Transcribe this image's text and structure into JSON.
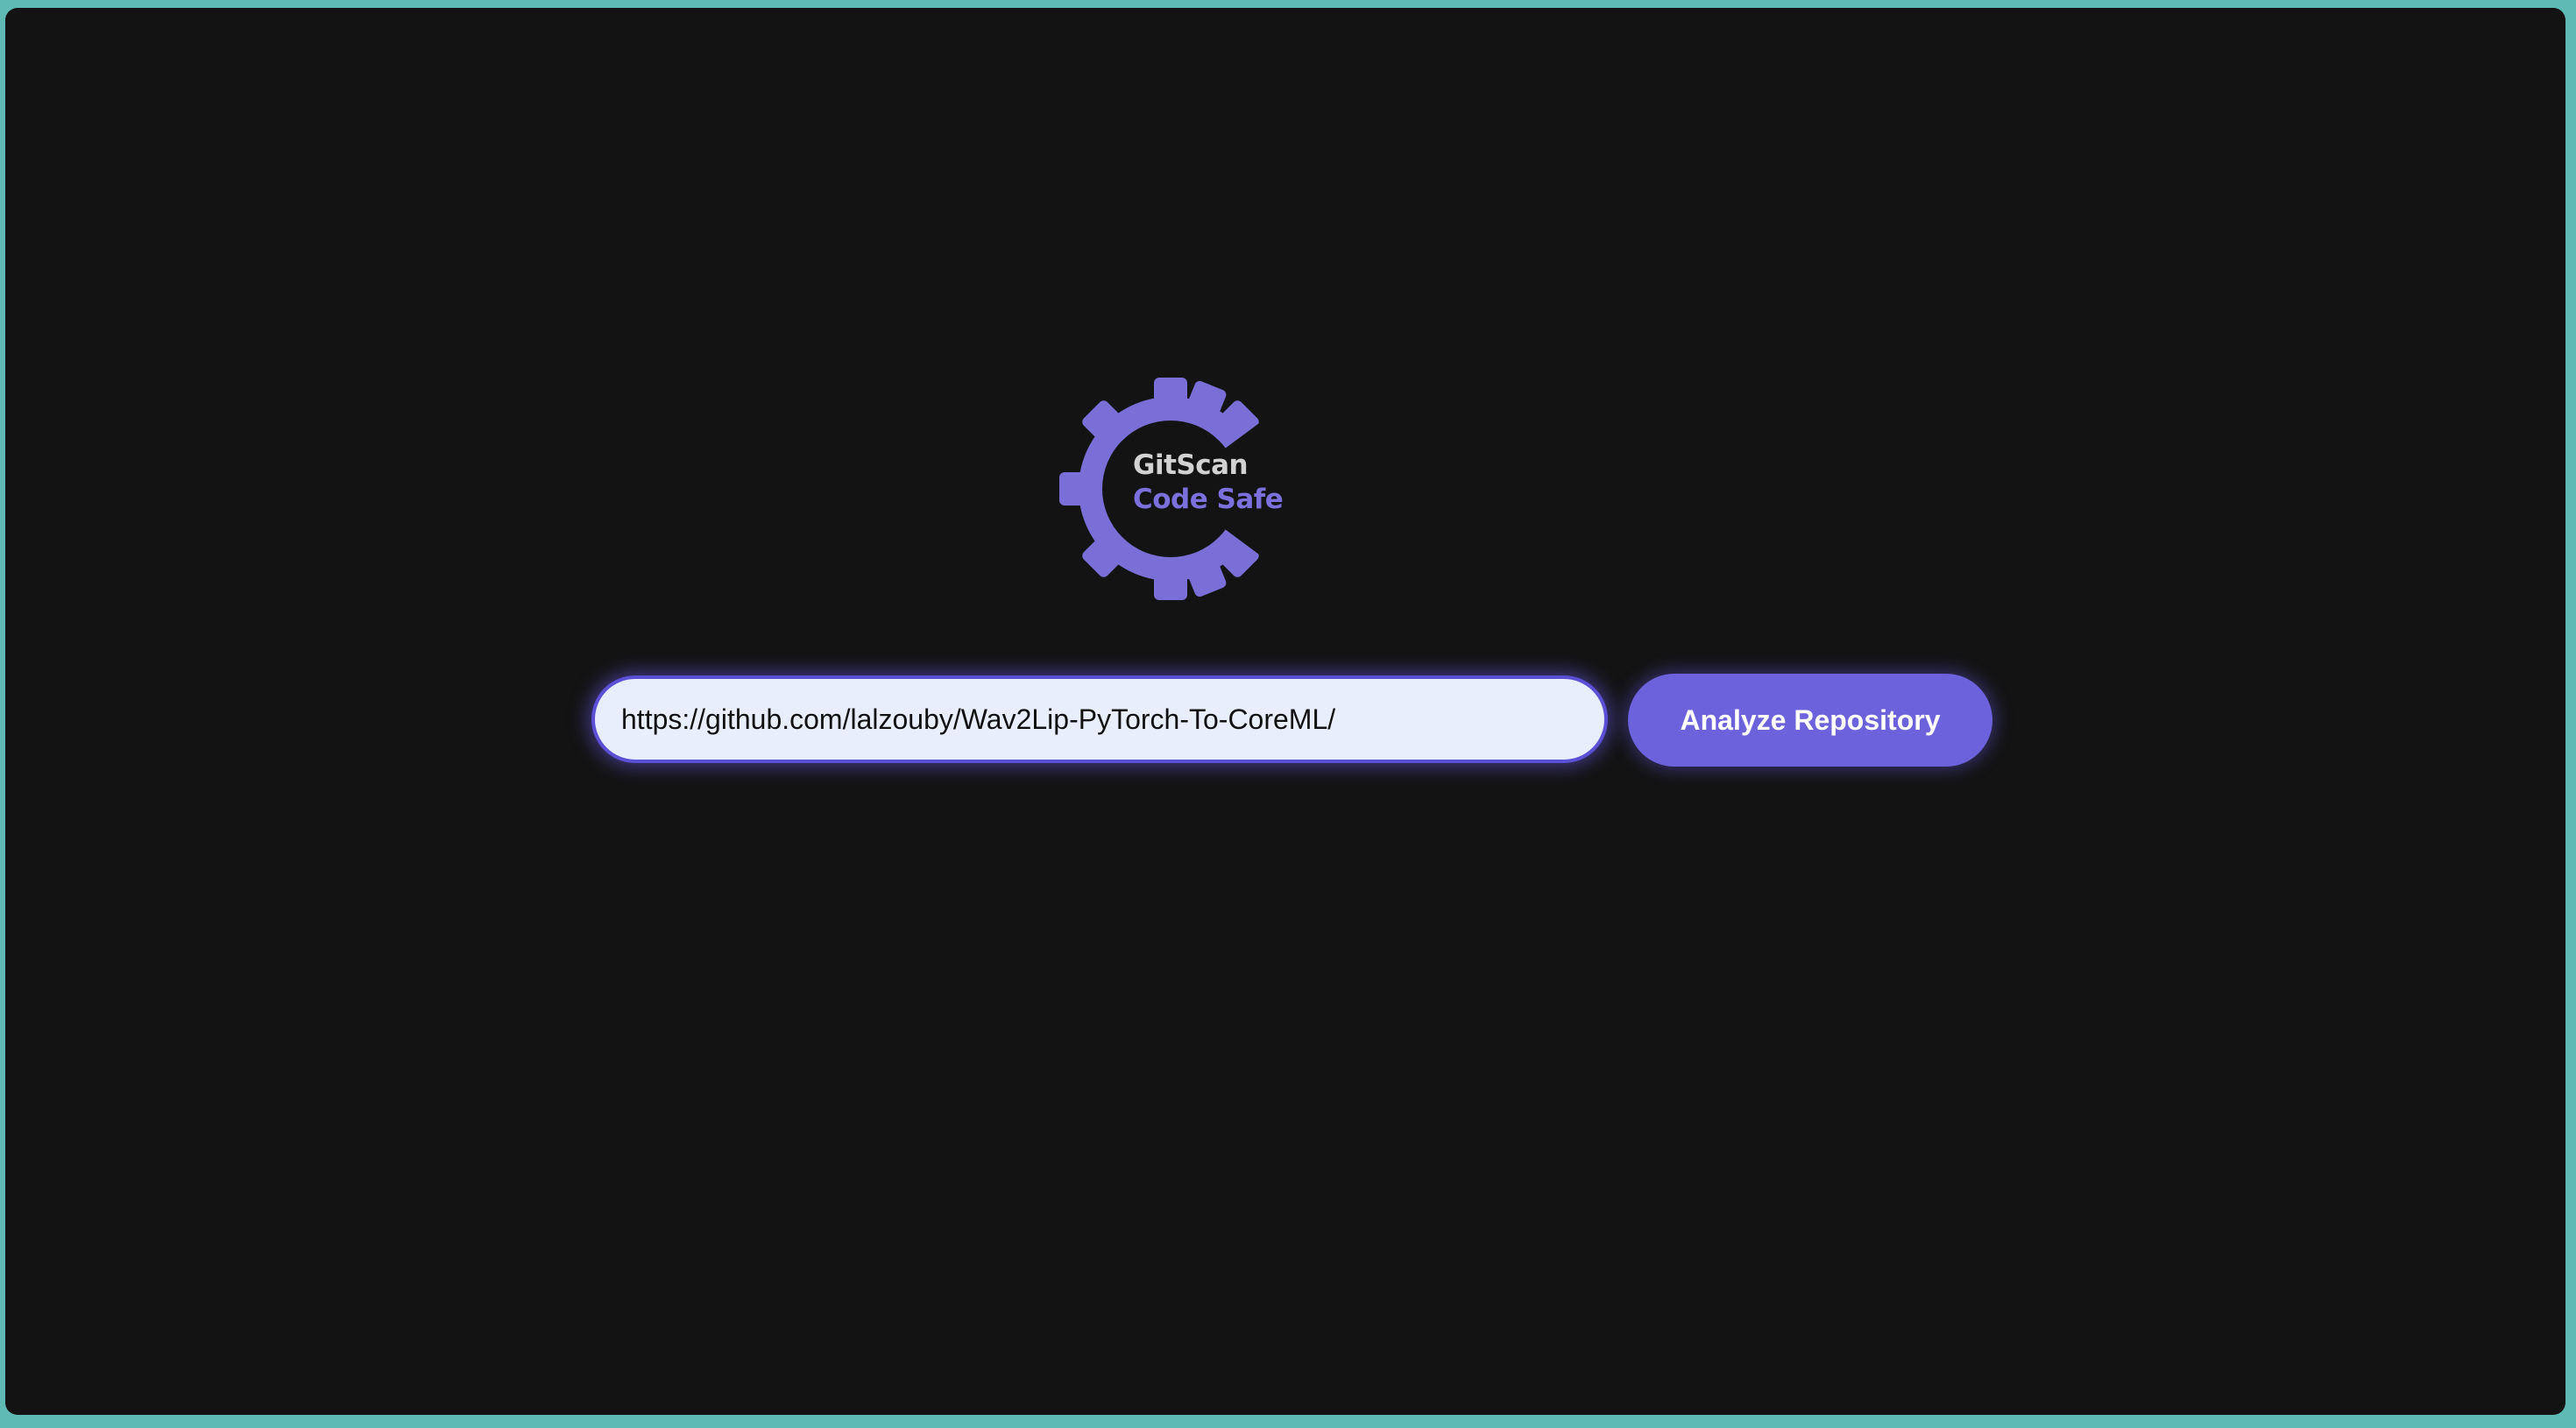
{
  "brand": {
    "logo_icon": "gear-icon",
    "line1": "GitScan",
    "line2": "Code Safe",
    "gear_color": "#7a6fd6",
    "line1_color": "#d2d2d2",
    "line2_color": "#7b70dc"
  },
  "search": {
    "value": "https://github.com/lalzouby/Wav2Lip-PyTorch-To-CoreML/",
    "placeholder": ""
  },
  "actions": {
    "analyze_label": "Analyze Repository",
    "accent": "#6c62dc"
  },
  "theme": {
    "background": "#131313",
    "frame": "#5fb9b4"
  }
}
